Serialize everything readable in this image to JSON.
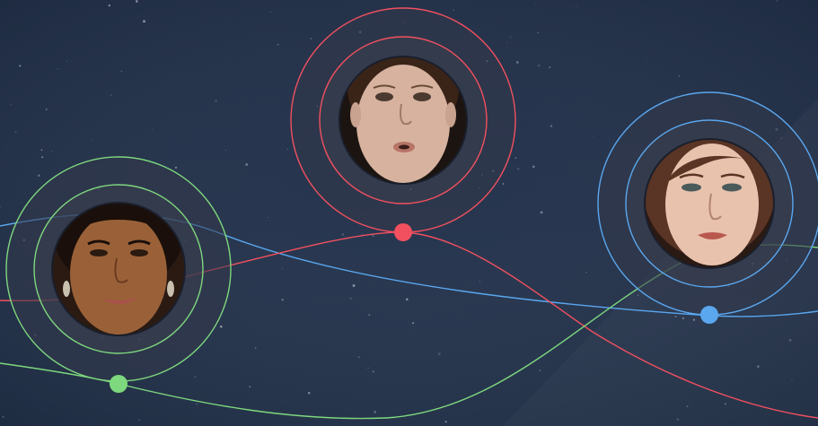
{
  "colors": {
    "background_top": "#1b2a44",
    "background_bottom": "#22324c",
    "accent_green": "#7ed87e",
    "accent_red": "#f2505f",
    "accent_blue": "#5aa7ef"
  },
  "nodes": [
    {
      "id": "left",
      "color": "accent_green",
      "skin": "#9a6138",
      "hair": "#1a0f0a",
      "lip": "#a8524a",
      "bg": "#2a1a12"
    },
    {
      "id": "center",
      "color": "accent_red",
      "skin": "#d7b29f",
      "hair": "#3a2418",
      "lip": "#b77466",
      "bg": "#1c1410"
    },
    {
      "id": "right",
      "color": "accent_blue",
      "skin": "#e8c2ad",
      "hair": "#5a3424",
      "lip": "#b9584e",
      "bg": "#2a1a14"
    }
  ]
}
